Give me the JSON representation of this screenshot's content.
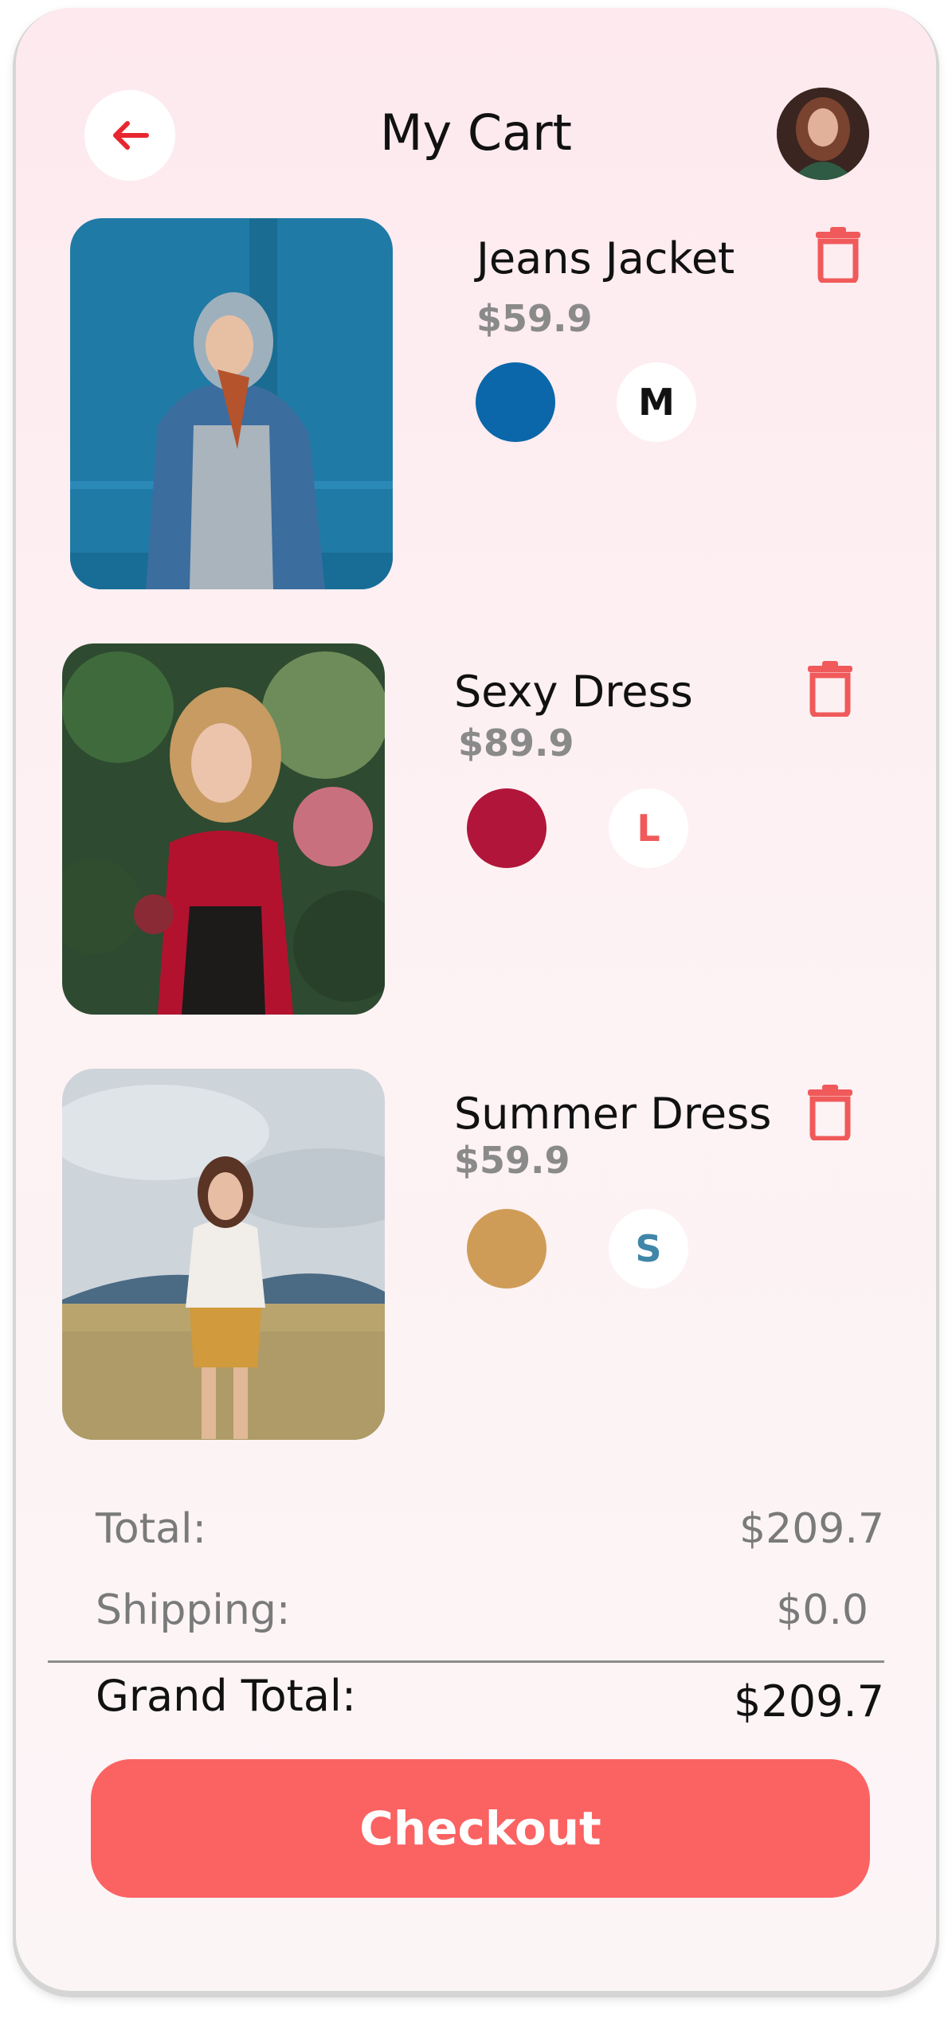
{
  "header": {
    "title": "My Cart",
    "back_icon": "arrow-left-icon",
    "avatar_icon": "user-avatar"
  },
  "colors": {
    "accent": "#fb6262",
    "back_arrow": "#e8262f",
    "jacket_swatch": "#0b67aa",
    "dress_swatch": "#b1153a",
    "summer_swatch": "#cf9c58"
  },
  "cart": {
    "items": [
      {
        "name": "Jeans Jacket",
        "price": "$59.9",
        "size": "M",
        "size_color": "#111111"
      },
      {
        "name": "Sexy Dress",
        "price": "$89.9",
        "size": "L",
        "size_color": "#f05a5a"
      },
      {
        "name": "Summer Dress",
        "price": "$59.9",
        "size": "S",
        "size_color": "#3f86a8"
      }
    ]
  },
  "summary": {
    "total_label": "Total:",
    "total_value": "$209.7",
    "shipping_label": "Shipping:",
    "shipping_value": "$0.0",
    "grand_label": "Grand Total:",
    "grand_value": "$209.7"
  },
  "checkout_label": "Checkout"
}
